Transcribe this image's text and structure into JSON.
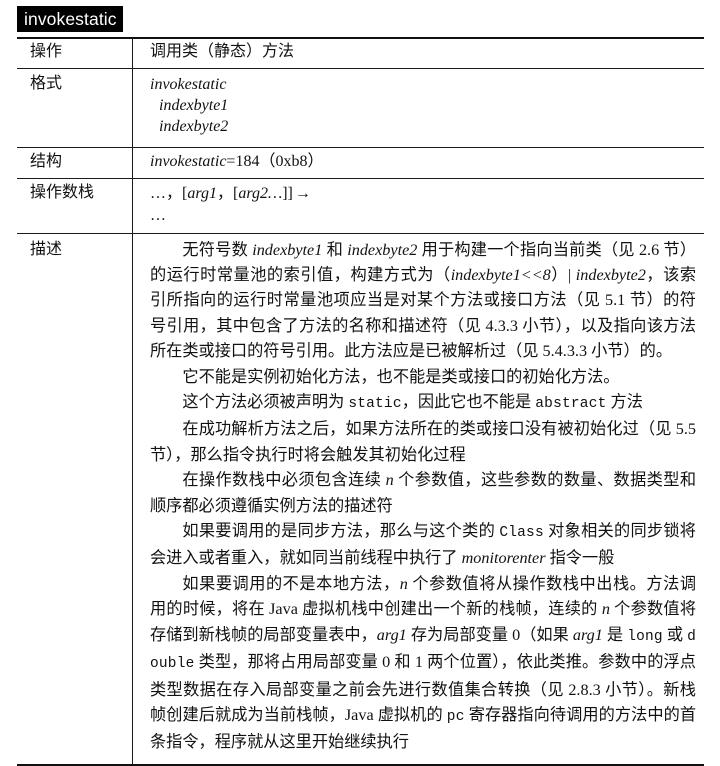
{
  "document": {
    "title": "invokestatic",
    "type": "jvm-instruction-reference-table"
  },
  "table": {
    "rows": [
      {
        "label": "操作",
        "kind": "operation",
        "value": "调用类（静态）方法"
      },
      {
        "label": "格式",
        "kind": "format",
        "lines": [
          "invokestatic",
          "indexbyte1",
          "indexbyte2"
        ]
      },
      {
        "label": "结构",
        "kind": "structure",
        "mnemonic": "invokestatic",
        "value_rest": "=184（0xb8）"
      },
      {
        "label": "操作数栈",
        "kind": "operand-stack",
        "line1_pre": "…，[",
        "line1_arg1": "arg1",
        "line1_mid": "，[",
        "line1_arg2": "arg2…",
        "line1_post": "]]",
        "line1_arrow": "→",
        "line2": "…"
      },
      {
        "label": "描述",
        "kind": "description",
        "paragraphs": [
          {
            "segments": [
              {
                "t": "无符号数 ",
                "s": "normal"
              },
              {
                "t": "indexbyte1",
                "s": "italic"
              },
              {
                "t": " 和 ",
                "s": "normal"
              },
              {
                "t": "indexbyte2",
                "s": "italic"
              },
              {
                "t": " 用于构建一个指向当前类（见 2.6 节）的运行时常量池的索引值，构建方式为（",
                "s": "normal"
              },
              {
                "t": "indexbyte1<<8",
                "s": "italic"
              },
              {
                "t": "）| ",
                "s": "normal"
              },
              {
                "t": "indexbyte2",
                "s": "italic"
              },
              {
                "t": "，该索引所指向的运行时常量池项应当是对某个方法或接口方法（见 5.1 节）的符号引用，其中包含了方法的名称和描述符（见 4.3.3 小节），以及指向该方法所在类或接口的符号引用。此方法应是已被解析过（见 5.4.3.3 小节）的。",
                "s": "normal"
              }
            ]
          },
          {
            "segments": [
              {
                "t": "它不能是实例初始化方法，也不能是类或接口的初始化方法。",
                "s": "normal"
              }
            ]
          },
          {
            "segments": [
              {
                "t": "这个方法必须被声明为 ",
                "s": "normal"
              },
              {
                "t": "static",
                "s": "mono"
              },
              {
                "t": "，因此它也不能是 ",
                "s": "normal"
              },
              {
                "t": "abstract",
                "s": "mono"
              },
              {
                "t": " 方法",
                "s": "normal"
              }
            ]
          },
          {
            "segments": [
              {
                "t": "在成功解析方法之后，如果方法所在的类或接口没有被初始化过（见 5.5 节），那么指令执行时将会触发其初始化过程",
                "s": "normal"
              }
            ]
          },
          {
            "segments": [
              {
                "t": "在操作数栈中必须包含连续 ",
                "s": "normal"
              },
              {
                "t": "n",
                "s": "italic"
              },
              {
                "t": " 个参数值，这些参数的数量、数据类型和顺序都必须遵循实例方法的描述符",
                "s": "normal"
              }
            ]
          },
          {
            "segments": [
              {
                "t": "如果要调用的是同步方法，那么与这个类的 ",
                "s": "normal"
              },
              {
                "t": "Class",
                "s": "mono"
              },
              {
                "t": " 对象相关的同步锁将会进入或者重入，就如同当前线程中执行了 ",
                "s": "normal"
              },
              {
                "t": "monitorenter",
                "s": "italic"
              },
              {
                "t": " 指令一般",
                "s": "normal"
              }
            ]
          },
          {
            "segments": [
              {
                "t": "如果要调用的不是本地方法，",
                "s": "normal"
              },
              {
                "t": "n",
                "s": "italic"
              },
              {
                "t": " 个参数值将从操作数栈中出栈。方法调用的时候，将在 Java 虚拟机栈中创建出一个新的栈帧，连续的 ",
                "s": "normal"
              },
              {
                "t": "n",
                "s": "italic"
              },
              {
                "t": " 个参数值将存储到新栈帧的局部变量表中，",
                "s": "normal"
              },
              {
                "t": "arg1",
                "s": "italic"
              },
              {
                "t": " 存为局部变量 0（如果 ",
                "s": "normal"
              },
              {
                "t": "arg1",
                "s": "italic"
              },
              {
                "t": " 是 ",
                "s": "normal"
              },
              {
                "t": "long",
                "s": "mono"
              },
              {
                "t": " 或 ",
                "s": "normal"
              },
              {
                "t": "double",
                "s": "mono"
              },
              {
                "t": " 类型，那将占用局部变量 0 和 1 两个位置），依此类推。参数中的浮点类型数据在存入局部变量之前会先进行数值集合转换（见 2.8.3 小节）。新栈帧创建后就成为当前栈帧，Java 虚拟机的 ",
                "s": "normal"
              },
              {
                "t": "pc",
                "s": "mono"
              },
              {
                "t": " 寄存器指向待调用的方法中的首条指令，程序就从这里开始继续执行",
                "s": "normal"
              }
            ]
          }
        ]
      }
    ]
  },
  "colors": {
    "title_background": "#000000",
    "title_text": "#ffffff",
    "rule": "#1a1a1a",
    "page_background": "#ffffff",
    "body_text": "#111111"
  }
}
